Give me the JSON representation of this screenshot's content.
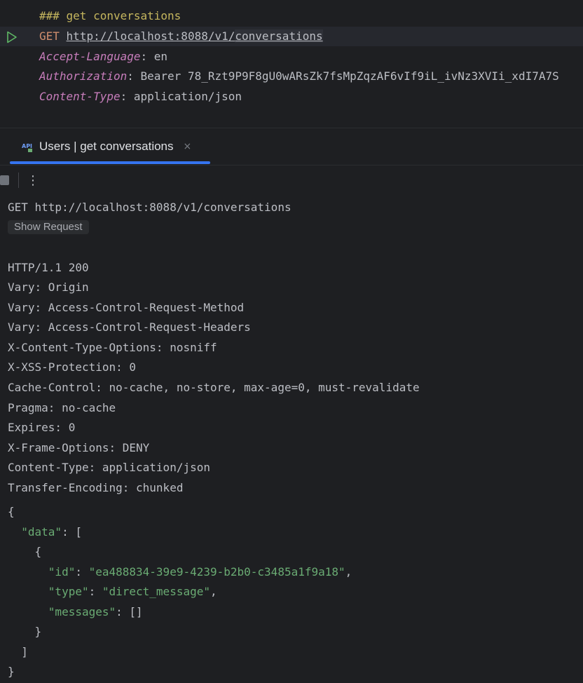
{
  "editor": {
    "comment": "### get conversations",
    "method": "GET",
    "url_highlighted": "http://localhost:8088/v1/",
    "url_rest": "conversations",
    "headers": [
      {
        "name": "Accept-Language",
        "value": "en"
      },
      {
        "name": "Authorization",
        "value": "Bearer 78_Rzt9P9F8gU0wARsZk7fsMpZqzAF6vIf9iL_ivNz3XVIi_xdI7A7S"
      },
      {
        "name": "Content-Type",
        "value": "application/json"
      }
    ]
  },
  "tab": {
    "icon": "api-icon",
    "label": "Users | get conversations",
    "close": "×"
  },
  "toolbar": {
    "more": "⋮"
  },
  "response": {
    "request_line": "GET http://localhost:8088/v1/conversations",
    "show_request_label": "Show Request",
    "status_line": "HTTP/1.1 200",
    "headers": [
      "Vary: Origin",
      "Vary: Access-Control-Request-Method",
      "Vary: Access-Control-Request-Headers",
      "X-Content-Type-Options: nosniff",
      "X-XSS-Protection: 0",
      "Cache-Control: no-cache, no-store, max-age=0, must-revalidate",
      "Pragma: no-cache",
      "Expires: 0",
      "X-Frame-Options: DENY",
      "Content-Type: application/json",
      "Transfer-Encoding: chunked"
    ],
    "body": {
      "open_brace": "{",
      "data_key": "\"data\"",
      "open_bracket": "[",
      "obj_open": "{",
      "id_key": "\"id\"",
      "id_value": "\"ea488834-39e9-4239-b2b0-c3485a1f9a18\"",
      "type_key": "\"type\"",
      "type_value": "\"direct_message\"",
      "messages_key": "\"messages\"",
      "messages_value": "[]",
      "obj_close": "}",
      "close_bracket": "]",
      "close_brace": "}"
    }
  }
}
